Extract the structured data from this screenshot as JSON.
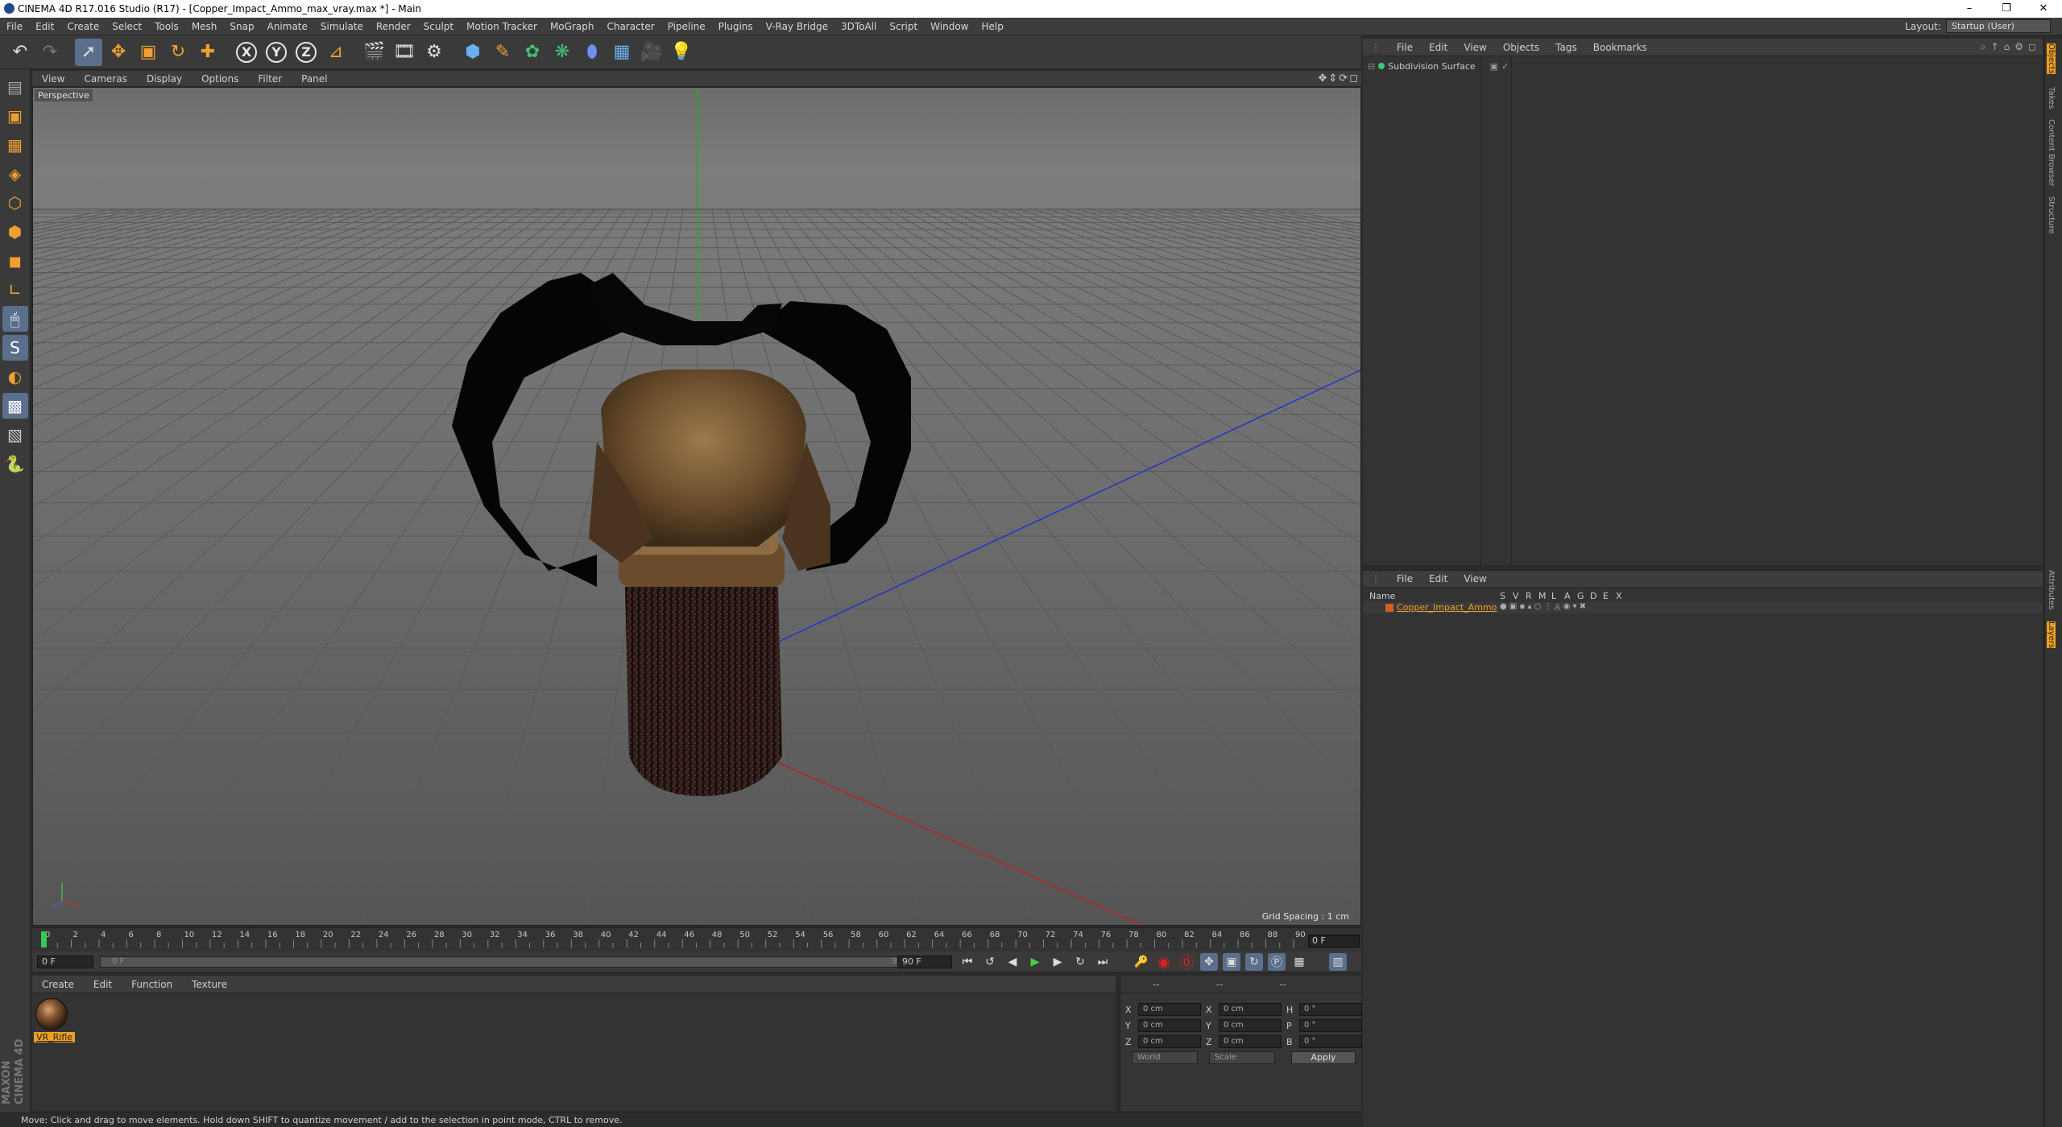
{
  "window": {
    "title": "CINEMA 4D R17.016 Studio (R17) - [Copper_Impact_Ammo_max_vray.max *] - Main",
    "controls": [
      "–",
      "❐",
      "✕"
    ]
  },
  "menubar": {
    "items": [
      "File",
      "Edit",
      "Create",
      "Select",
      "Tools",
      "Mesh",
      "Snap",
      "Animate",
      "Simulate",
      "Render",
      "Sculpt",
      "Motion Tracker",
      "MoGraph",
      "Character",
      "Pipeline",
      "Plugins",
      "V-Ray Bridge",
      "3DToAll",
      "Script",
      "Window",
      "Help"
    ],
    "layout_label": "Layout:",
    "layout_value": "Startup (User)"
  },
  "toolbar": {
    "icons": [
      "undo-icon",
      "redo-icon",
      "live-selection-icon",
      "move-icon",
      "scale-icon",
      "rotate-icon",
      "recent-tool-icon",
      "x-axis-icon",
      "y-axis-icon",
      "z-axis-icon",
      "coordinate-system-icon",
      "render-view-icon",
      "render-picture-viewer-icon",
      "render-settings-icon",
      "cube-icon",
      "pen-icon",
      "subdivision-icon",
      "cloner-icon",
      "deformer-icon",
      "floor-icon",
      "camera-icon",
      "light-icon"
    ],
    "axis_labels": [
      "X",
      "Y",
      "Z"
    ]
  },
  "viewport": {
    "menu": [
      "View",
      "Cameras",
      "Display",
      "Options",
      "Filter",
      "Panel"
    ],
    "label": "Perspective",
    "grid_spacing": "Grid Spacing : 1 cm"
  },
  "timeline": {
    "ticks": [
      "0",
      "2",
      "4",
      "6",
      "8",
      "10",
      "12",
      "14",
      "16",
      "18",
      "20",
      "22",
      "24",
      "26",
      "28",
      "30",
      "32",
      "34",
      "36",
      "38",
      "40",
      "42",
      "44",
      "46",
      "48",
      "50",
      "52",
      "54",
      "56",
      "58",
      "60",
      "62",
      "64",
      "66",
      "68",
      "70",
      "72",
      "74",
      "76",
      "78",
      "80",
      "82",
      "84",
      "86",
      "88",
      "90"
    ],
    "current_frame": "0 F",
    "start_frame": "0 F",
    "slider_start": "0 F",
    "slider_end": "90 F",
    "end_frame": "90 F"
  },
  "materials": {
    "menu": [
      "Create",
      "Edit",
      "Function",
      "Texture"
    ],
    "items": [
      {
        "name": "VR_Rifle"
      }
    ]
  },
  "coordinates": {
    "header": [
      "--",
      "--",
      "--"
    ],
    "rows": [
      {
        "a": "X",
        "v1": "0 cm",
        "b": "X",
        "v2": "0 cm",
        "c": "H",
        "v3": "0 °"
      },
      {
        "a": "Y",
        "v1": "0 cm",
        "b": "Y",
        "v2": "0 cm",
        "c": "P",
        "v3": "0 °"
      },
      {
        "a": "Z",
        "v1": "0 cm",
        "b": "Z",
        "v2": "0 cm",
        "c": "B",
        "v3": "0 °"
      }
    ],
    "space": "World",
    "mode": "Scale",
    "apply": "Apply"
  },
  "object_manager": {
    "menu": [
      "File",
      "Edit",
      "View",
      "Objects",
      "Tags",
      "Bookmarks"
    ],
    "objects": [
      {
        "name": "Subdivision Surface"
      }
    ]
  },
  "layer_manager": {
    "menu": [
      "File",
      "Edit",
      "View"
    ],
    "columns": [
      "Name",
      "S",
      "V",
      "R",
      "M",
      "L",
      "A",
      "G",
      "D",
      "E",
      "X"
    ],
    "layers": [
      {
        "name": "Copper_Impact_Ammo",
        "color": "#d06020"
      }
    ]
  },
  "side_tabs": [
    "Objects",
    "Takes",
    "Content Browser",
    "Structure",
    "Attributes",
    "Layers"
  ],
  "statusbar": {
    "text": "Move: Click and drag to move elements. Hold down SHIFT to quantize movement / add to the selection in point mode, CTRL to remove."
  },
  "colors": {
    "accent": "#f0a020",
    "selected": "#5a6f8c",
    "panel": "#333333"
  }
}
